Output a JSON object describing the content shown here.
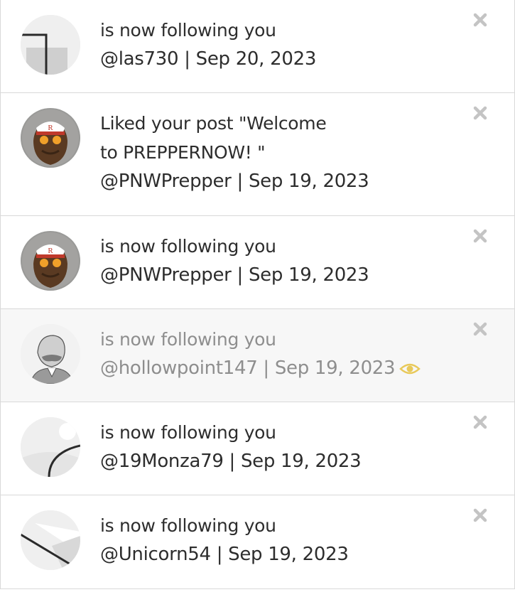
{
  "colors": {
    "text": "#2d2d2d",
    "muted_text": "#8e8e8e",
    "divider": "#d9d9d9",
    "read_background": "#f7f7f7",
    "close_icon": "#c4c4c4",
    "eye_icon": "#e8c95a"
  },
  "notifications": [
    {
      "message": "is now following you",
      "user": "@las730",
      "date": "Sep 20, 2023",
      "avatar": "placeholder-avatar-1",
      "seen": false
    },
    {
      "message": "Liked your post \"Welcome to PREPPERNOW! \"",
      "user": "@PNWPrepper",
      "date": "Sep 19, 2023",
      "avatar": "sasquatch-avatar",
      "seen": false
    },
    {
      "message": "is now following you",
      "user": "@PNWPrepper",
      "date": "Sep 19, 2023",
      "avatar": "sasquatch-avatar",
      "seen": false
    },
    {
      "message": "is now following you",
      "user": "@hollowpoint147",
      "date": "Sep 19, 2023",
      "avatar": "portrait-engraving-avatar",
      "seen": true
    },
    {
      "message": "is now following you",
      "user": "@19Monza79",
      "date": "Sep 19, 2023",
      "avatar": "placeholder-avatar-2",
      "seen": false
    },
    {
      "message": "is now following you",
      "user": "@Unicorn54",
      "date": "Sep 19, 2023",
      "avatar": "placeholder-avatar-3",
      "seen": false
    }
  ],
  "separator": " | "
}
